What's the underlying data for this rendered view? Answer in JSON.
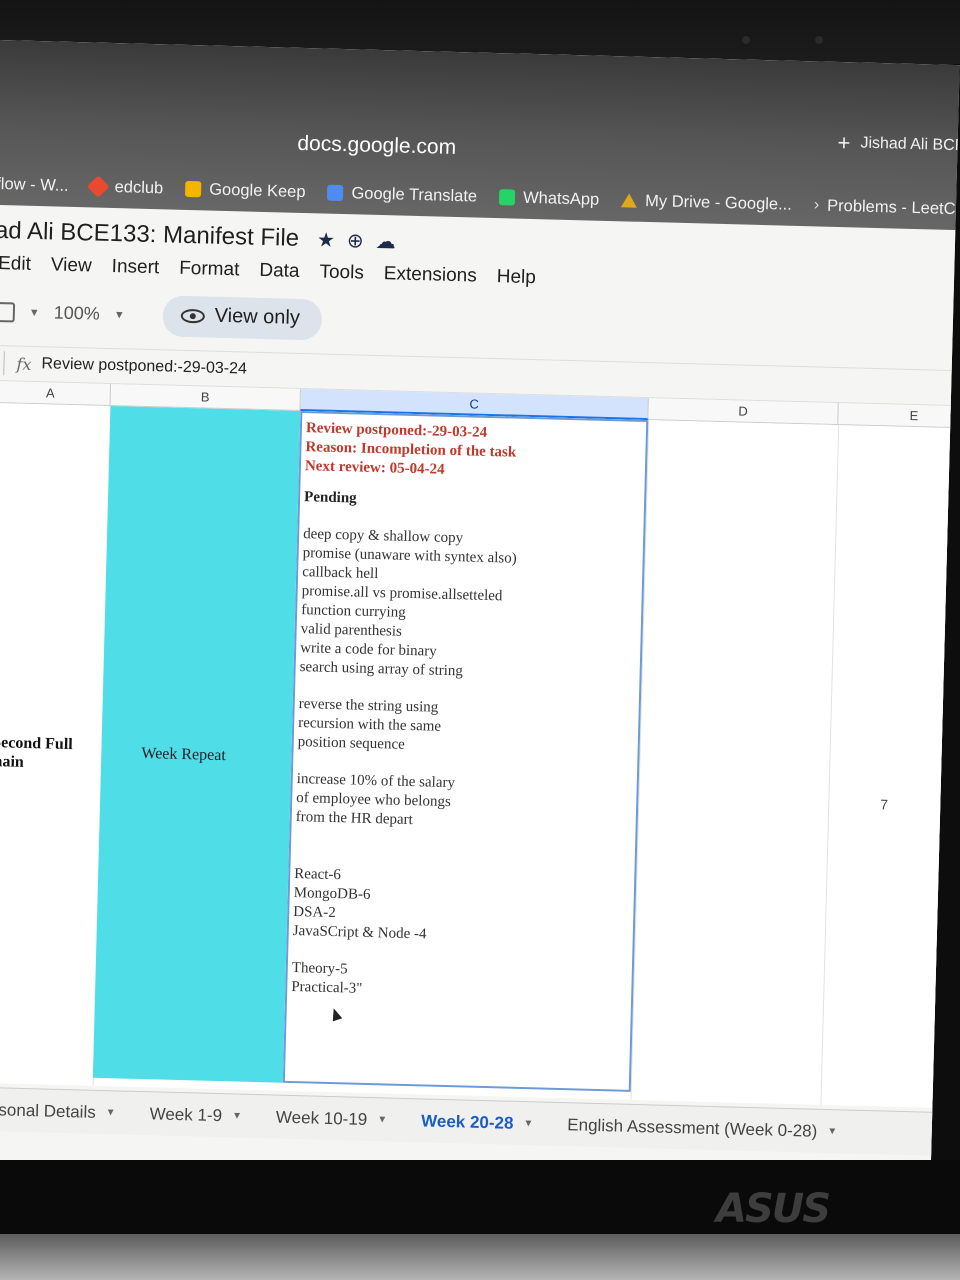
{
  "browser": {
    "url": "docs.google.com",
    "profile_label": "Jishad Ali BCE",
    "bookmarks": [
      {
        "label": "flow - W...",
        "icon": "stack-icon"
      },
      {
        "label": "edclub",
        "icon": "edclub-icon"
      },
      {
        "label": "Google Keep",
        "icon": "keep-icon"
      },
      {
        "label": "Google Translate",
        "icon": "translate-icon"
      },
      {
        "label": "WhatsApp",
        "icon": "whatsapp-icon"
      },
      {
        "label": "My Drive - Google...",
        "icon": "drive-icon"
      },
      {
        "label": "Problems - LeetC",
        "icon": "leetcode-icon"
      }
    ]
  },
  "doc": {
    "title": "ad Ali BCE133: Manifest File",
    "menu": [
      "Edit",
      "View",
      "Insert",
      "Format",
      "Data",
      "Tools",
      "Extensions",
      "Help"
    ],
    "zoom": "100%",
    "mode_label": "View only",
    "formula_bar": "Review postponed:-29-03-24"
  },
  "columns": [
    "A",
    "B",
    "C",
    "D",
    "E"
  ],
  "cells": {
    "a_text": [
      "):Second Full",
      "omain"
    ],
    "b_text": "Week Repeat",
    "e_value": "7",
    "c": {
      "review": [
        "Review postponed:-29-03-24",
        "Reason: Incompletion of the task",
        "Next review: 05-04-24"
      ],
      "pending_label": "Pending",
      "group1": [
        "deep copy & shallow copy",
        "promise (unaware with syntex also)",
        "callback hell",
        "promise.all vs promise.allsetteled",
        "function currying",
        "valid parenthesis",
        "write a code for binary",
        "search using array of string"
      ],
      "group2": [
        "reverse the string using",
        "recursion with the same",
        "position sequence"
      ],
      "group3": [
        "increase 10% of the salary",
        "of employee who belongs",
        "from the HR depart"
      ],
      "group4": [
        "React-6",
        "MongoDB-6",
        "DSA-2",
        "JavaSCript & Node -4"
      ],
      "group5": [
        "Theory-5",
        "Practical-3\""
      ]
    }
  },
  "sheet_tabs": [
    "Personal Details",
    "Week 1-9",
    "Week 10-19",
    "Week 20-28",
    "English Assessment (Week 0-28)"
  ],
  "active_tab": "Week 20-28",
  "brand": "ASUS",
  "colors": {
    "highlight_b": "#4fdde8",
    "review_red": "#c0392b",
    "active_tab": "#1a5dc7"
  }
}
